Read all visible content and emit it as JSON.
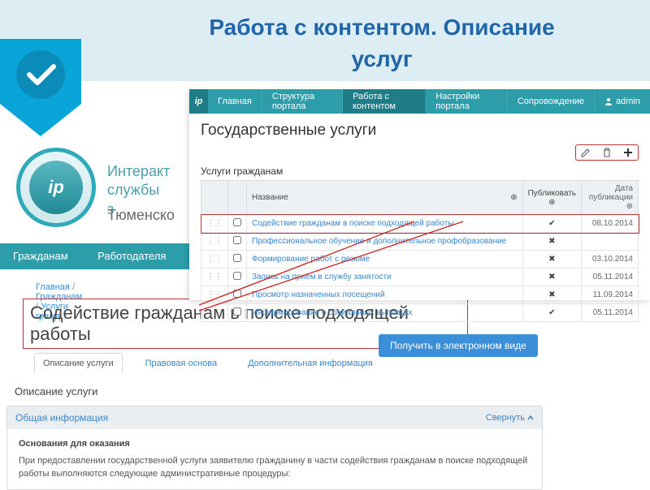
{
  "header": {
    "title_line1": "Работа с контентом. Описание",
    "title_line2": "услуг"
  },
  "portal": {
    "name_line1": "Интеракт",
    "name_line2": "службы з",
    "region": "Тюменско",
    "tabs": [
      "Гражданам",
      "Работодателя"
    ]
  },
  "breadcrumb": {
    "items": [
      "Главная",
      "Гражданам",
      "Услуги гражд"
    ],
    "sep": " / "
  },
  "main_title": "Содействие гражданам в поиске подходящей работы",
  "admin": {
    "menu": [
      "Главная",
      "Структура портала",
      "Работа с контентом",
      "Настройки портала",
      "Сопровождение"
    ],
    "active_index": 2,
    "user": "admin",
    "page_title": "Государственные услуги",
    "subhead": "Услуги гражданам",
    "columns": {
      "name": "Название",
      "publish": "Публиковать",
      "date": "Дата публикации"
    },
    "rows": [
      {
        "name": "Содействие гражданам в поиске подходящей работы",
        "publish": true,
        "date": "08.10.2014",
        "selected": true
      },
      {
        "name": "Профессиональное обучение и дополнительное профобразование",
        "publish": false,
        "date": ""
      },
      {
        "name": "Формирование работ с резюме",
        "publish": false,
        "date": "03.10.2014"
      },
      {
        "name": "Запись на прием в службу занятости",
        "publish": false,
        "date": "05.11.2014"
      },
      {
        "name": "Просмотр назначенных посещений",
        "publish": false,
        "date": "11.09.2014"
      },
      {
        "name": "Информирование о социальных выплатах",
        "publish": true,
        "date": "05.11.2014"
      }
    ]
  },
  "eservice_button": "Получить в электронном виде",
  "sub_tabs": [
    "Описание услуги",
    "Правовая основа",
    "Дополнительная информация"
  ],
  "section_label": "Описание услуги",
  "info_panel": {
    "title": "Общая информация",
    "collapse": "Свернуть",
    "block_heading": "Основания для оказания",
    "block_text": "При предоставлении государственной услуги заявителю гражданину в части содействия гражданам в поиске подходящей работы выполняются следующие административные процедуры:"
  }
}
